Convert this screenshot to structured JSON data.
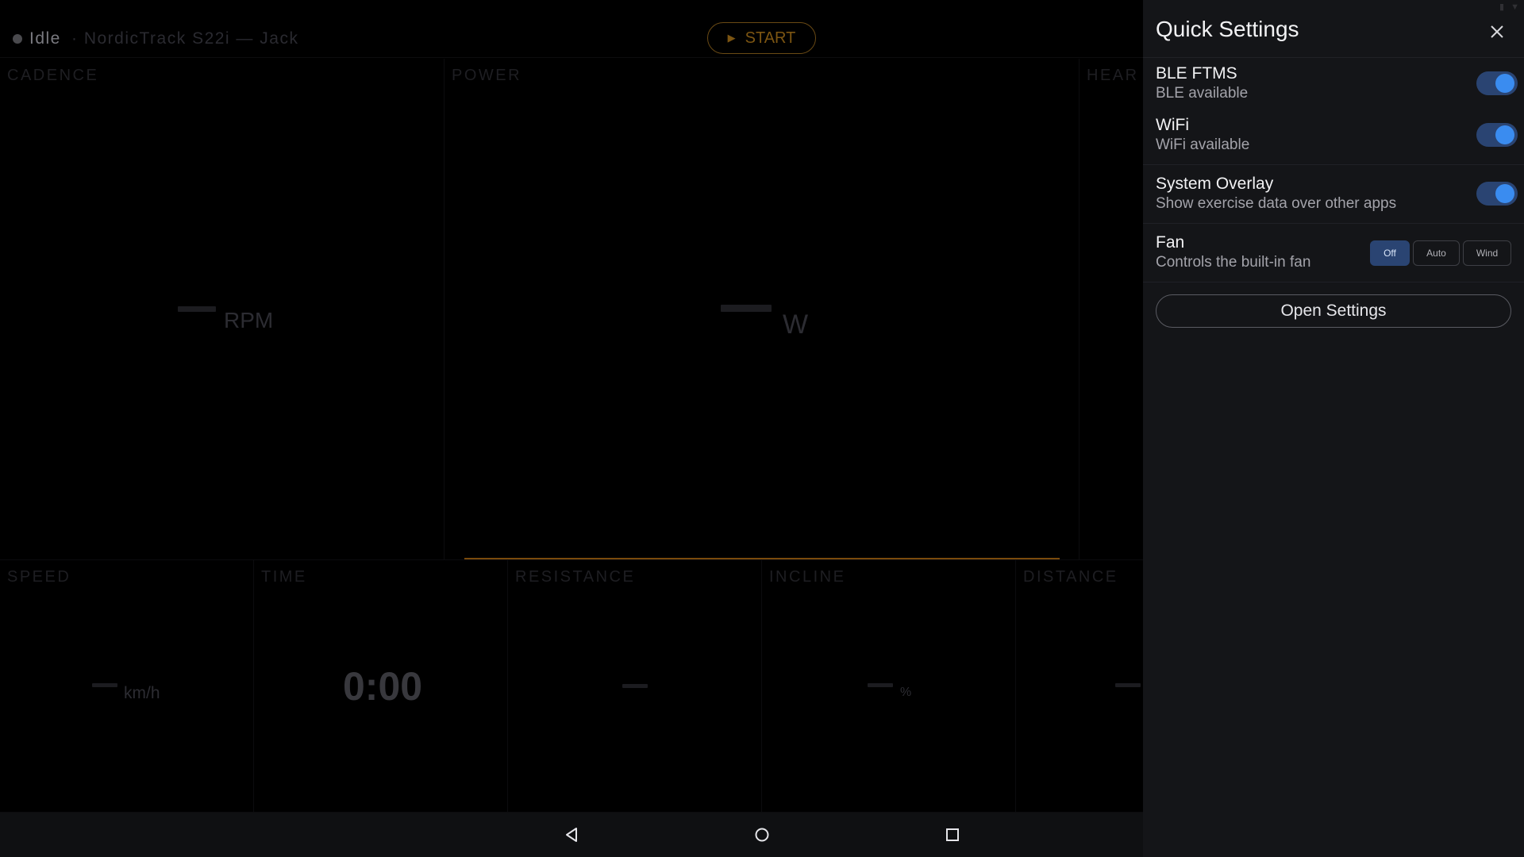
{
  "dashboard": {
    "status": "Idle",
    "device": "· NordicTrack S22i — Jack",
    "start_label": "START",
    "tiles": {
      "cadence": {
        "label": "CADENCE",
        "value": "",
        "unit": "RPM"
      },
      "power": {
        "label": "POWER",
        "value": "",
        "unit": "W"
      },
      "heart_rate": {
        "label": "HEAR"
      },
      "speed": {
        "label": "SPEED",
        "value": "",
        "unit": "km/h"
      },
      "time": {
        "label": "TIME",
        "value": "0:00"
      },
      "resistance": {
        "label": "RESISTANCE",
        "value": ""
      },
      "incline": {
        "label": "INCLINE",
        "value": "",
        "unit": "%"
      },
      "distance": {
        "label": "DISTANCE",
        "value": ""
      }
    }
  },
  "quick_settings": {
    "title": "Quick Settings",
    "close_icon": "close-icon",
    "items": [
      {
        "title": "BLE FTMS",
        "subtitle": "BLE available",
        "enabled": true
      },
      {
        "title": "WiFi",
        "subtitle": "WiFi available",
        "enabled": true
      },
      {
        "title": "System Overlay",
        "subtitle": "Show exercise data over other apps",
        "enabled": true
      }
    ],
    "fan": {
      "title": "Fan",
      "subtitle": "Controls the built-in fan",
      "options": [
        "Off",
        "Auto",
        "Wind"
      ],
      "selected": "Off"
    },
    "open_settings_label": "Open Settings"
  },
  "nav": {
    "back_icon": "back-icon",
    "home_icon": "home-icon",
    "recents_icon": "recents-icon"
  },
  "colors": {
    "accent": "#3a8cf0",
    "toggle_track": "#2a4472",
    "start_accent": "#7c5512",
    "panel_bg": "#141518"
  }
}
